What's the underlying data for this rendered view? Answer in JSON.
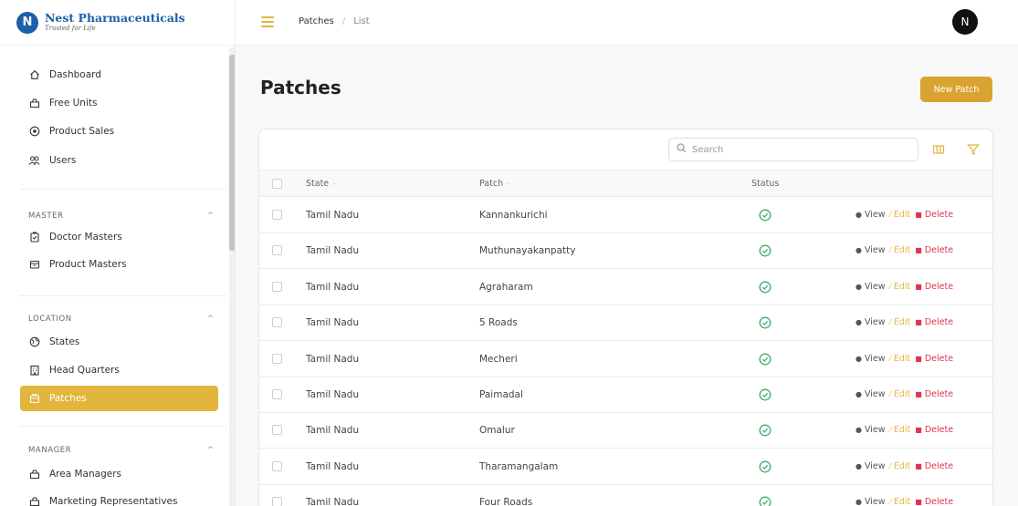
{
  "brand": {
    "logo_letter": "N",
    "name": "Nest Pharmaceuticals",
    "tagline": "Trusted for Life"
  },
  "sidebar": {
    "items": [
      {
        "label": "Dashboard",
        "icon": "home-icon"
      },
      {
        "label": "Free Units",
        "icon": "bag-icon"
      },
      {
        "label": "Product Sales",
        "icon": "coin-icon"
      },
      {
        "label": "Users",
        "icon": "users-icon"
      }
    ],
    "sections": [
      {
        "label": "MASTER",
        "items": [
          {
            "label": "Doctor Masters",
            "icon": "clipboard-icon"
          },
          {
            "label": "Product Masters",
            "icon": "box-icon"
          }
        ]
      },
      {
        "label": "LOCATION",
        "items": [
          {
            "label": "States",
            "icon": "globe-icon"
          },
          {
            "label": "Head Quarters",
            "icon": "building-icon"
          },
          {
            "label": "Patches",
            "icon": "patch-icon",
            "active": true
          }
        ]
      },
      {
        "label": "MANAGER",
        "items": [
          {
            "label": "Area Managers",
            "icon": "bag-icon"
          },
          {
            "label": "Marketing Representatives",
            "icon": "bag-icon"
          }
        ]
      }
    ]
  },
  "topbar": {
    "breadcrumb": [
      "Patches",
      "List"
    ],
    "avatar_letter": "N"
  },
  "page": {
    "title": "Patches",
    "new_button": "New Patch"
  },
  "table": {
    "search_placeholder": "Search",
    "columns": {
      "state": "State",
      "patch": "Patch",
      "status": "Status"
    },
    "actions": {
      "view": "View",
      "edit": "Edit",
      "delete": "Delete"
    },
    "rows": [
      {
        "state": "Tamil Nadu",
        "patch": "Kannankurichi",
        "status": "active"
      },
      {
        "state": "Tamil Nadu",
        "patch": "Muthunayakanpatty",
        "status": "active"
      },
      {
        "state": "Tamil Nadu",
        "patch": "Agraharam",
        "status": "active"
      },
      {
        "state": "Tamil Nadu",
        "patch": "5 Roads",
        "status": "active"
      },
      {
        "state": "Tamil Nadu",
        "patch": "Mecheri",
        "status": "active"
      },
      {
        "state": "Tamil Nadu",
        "patch": "Paimadal",
        "status": "active"
      },
      {
        "state": "Tamil Nadu",
        "patch": "Omalur",
        "status": "active"
      },
      {
        "state": "Tamil Nadu",
        "patch": "Tharamangalam",
        "status": "active"
      },
      {
        "state": "Tamil Nadu",
        "patch": "Four Roads",
        "status": "active"
      }
    ]
  },
  "colors": {
    "accent": "#e2b53d",
    "button": "#d9a332",
    "status_green": "#3cae6b",
    "delete_red": "#e0344d",
    "brand_blue": "#1d5fa8"
  }
}
